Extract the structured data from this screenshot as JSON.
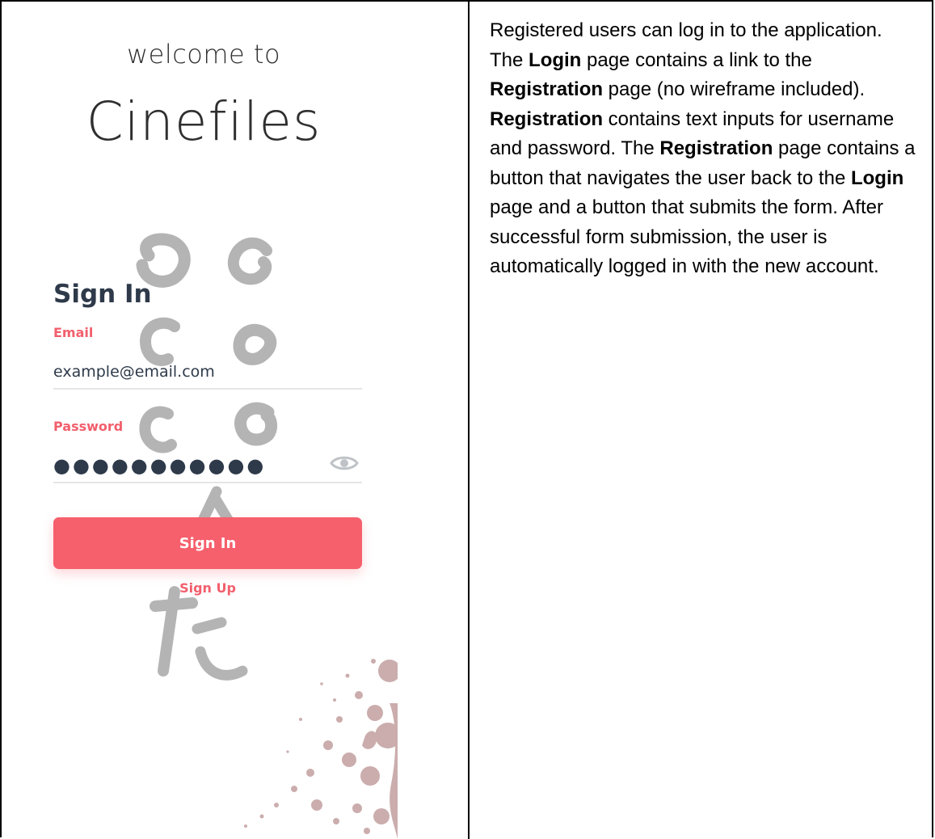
{
  "app": {
    "welcome_text": "welcome to",
    "brand_name": "Cinefiles"
  },
  "form": {
    "heading": "Sign In",
    "email_label": "Email",
    "email_value": "example@email.com",
    "password_label": "Password",
    "password_value": "●●●●●●●●●●●",
    "show_password_icon": "eye-icon",
    "submit_label": "Sign In",
    "signup_label": "Sign Up"
  },
  "description": {
    "segments": [
      {
        "text": "Registered users can log in to the application. The ",
        "bold": false
      },
      {
        "text": "Login",
        "bold": true
      },
      {
        "text": " page contains a link to the ",
        "bold": false
      },
      {
        "text": "Registration",
        "bold": true
      },
      {
        "text": " page (no wireframe included). ",
        "bold": false
      },
      {
        "text": "Registration",
        "bold": true
      },
      {
        "text": " contains text inputs for username and password. The ",
        "bold": false
      },
      {
        "text": "Registration",
        "bold": true
      },
      {
        "text": " page contains a button that navigates the user back to the ",
        "bold": false
      },
      {
        "text": "Login",
        "bold": true
      },
      {
        "text": " page and a button that submits the form. After successful form submission, the user is automatically logged in with the new account.",
        "bold": false
      }
    ]
  },
  "colors": {
    "accent": "#f65f6c",
    "label": "#f25f6c",
    "heading": "#2e3a4a",
    "watermark": "#b4b4b4",
    "splatter": "#c9a9a9"
  }
}
